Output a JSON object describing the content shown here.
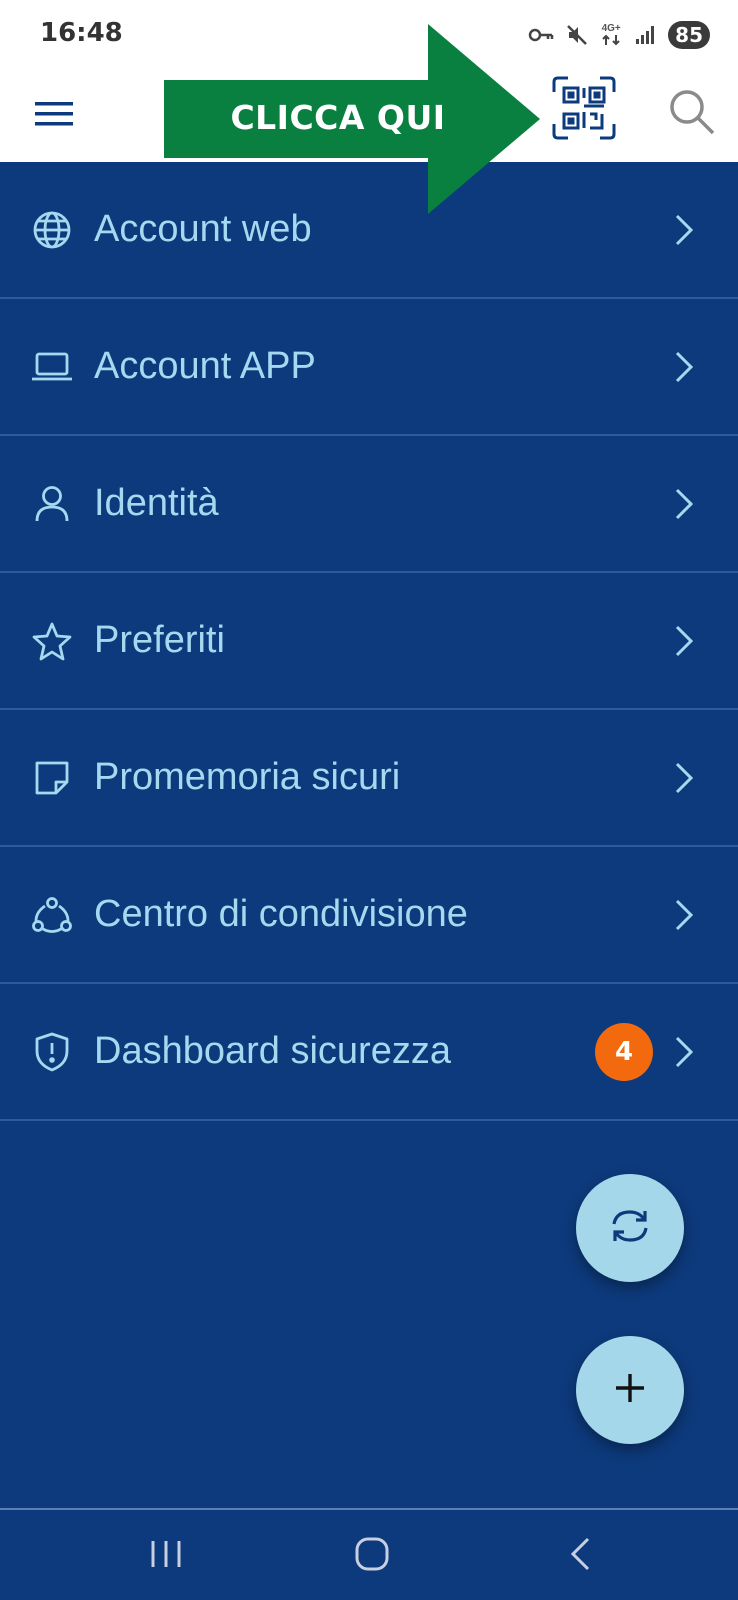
{
  "status_bar": {
    "time": "16:48",
    "network": "4G+",
    "battery": "85",
    "icons": [
      "key-icon",
      "mute-icon",
      "network-icon",
      "signal-icon",
      "battery-icon"
    ]
  },
  "app_bar": {
    "icons": [
      "hamburger-menu-icon",
      "qr-scan-icon",
      "search-icon"
    ]
  },
  "annotation": {
    "label": "CLICCA QUI",
    "color": "#0a8040"
  },
  "menu": {
    "items": [
      {
        "label": "Account web",
        "icon": "globe-icon"
      },
      {
        "label": "Account APP",
        "icon": "laptop-icon"
      },
      {
        "label": "Identità",
        "icon": "person-icon"
      },
      {
        "label": "Preferiti",
        "icon": "star-icon"
      },
      {
        "label": "Promemoria sicuri",
        "icon": "note-icon"
      },
      {
        "label": "Centro di condivisione",
        "icon": "share-icon"
      },
      {
        "label": "Dashboard sicurezza",
        "icon": "shield-icon",
        "badge": "4"
      }
    ]
  },
  "fabs": {
    "sync": "sync-icon",
    "add": "plus-icon"
  },
  "colors": {
    "background": "#0d3a7c",
    "text": "#a6d8ef",
    "badge": "#f26a0d",
    "fab": "#a5d7ea",
    "header": "#ffffff"
  }
}
